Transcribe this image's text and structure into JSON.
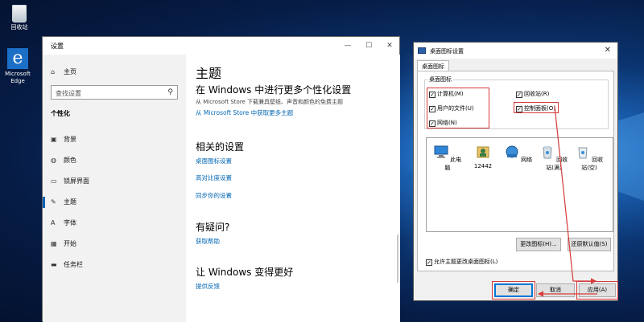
{
  "desktop": {
    "icons": [
      {
        "label": "回收站",
        "icon": "recycle-bin-icon"
      },
      {
        "label": "Microsoft Edge",
        "icon": "edge-icon"
      }
    ]
  },
  "settings": {
    "window_title": "设置",
    "controls": {
      "minimize": "—",
      "maximize": "☐",
      "close": "✕"
    },
    "sidebar": {
      "home": "主页",
      "search_placeholder": "查找设置",
      "section": "个性化",
      "items": [
        {
          "label": "背景",
          "icon": "picture-icon"
        },
        {
          "label": "颜色",
          "icon": "palette-icon"
        },
        {
          "label": "锁屏界面",
          "icon": "lock-screen-icon"
        },
        {
          "label": "主题",
          "icon": "brush-icon"
        },
        {
          "label": "字体",
          "icon": "font-icon"
        },
        {
          "label": "开始",
          "icon": "start-icon"
        },
        {
          "label": "任务栏",
          "icon": "taskbar-icon"
        }
      ],
      "selected_index": 3
    },
    "main": {
      "title": "主题",
      "store_heading": "在 Windows 中进行更多个性化设置",
      "store_desc": "从 Microsoft Store 下载兼具壁纸、声音和颜色的免费主题",
      "store_link": "从 Microsoft Store 中获取更多主题",
      "related_heading": "相关的设置",
      "related_links": [
        "桌面图标设置",
        "高对比度设置",
        "同步你的设置"
      ],
      "question_heading": "有疑问?",
      "help_link": "获取帮助",
      "improve_heading": "让 Windows 变得更好",
      "feedback_link": "提供反馈"
    }
  },
  "dialog": {
    "title": "桌面图标设置",
    "close": "✕",
    "tab": "桌面图标",
    "group_label": "桌面图标",
    "checkboxes": [
      {
        "label": "计算机(M)",
        "checked": true
      },
      {
        "label": "回收站(R)",
        "checked": true
      },
      {
        "label": "用户的文件(U)",
        "checked": true
      },
      {
        "label": "控制面板(O)",
        "checked": true
      },
      {
        "label": "网络(N)",
        "checked": true
      }
    ],
    "icons": [
      {
        "label": "此电脑",
        "icon": "computer-icon"
      },
      {
        "label": "12442",
        "icon": "user-folder-icon"
      },
      {
        "label": "网络",
        "icon": "network-icon"
      },
      {
        "label": "回收站(满)",
        "icon": "recycle-bin-full-icon"
      },
      {
        "label": "回收站(空)",
        "icon": "recycle-bin-empty-icon"
      }
    ],
    "change_icon_button": "更改图标(H)...",
    "restore_default_button": "还原默认值(S)",
    "allow_themes_label": "允许主题更改桌面图标(L)",
    "allow_themes_checked": true,
    "ok_button": "确定",
    "cancel_button": "取消",
    "apply_button": "应用(A)"
  },
  "colors": {
    "accent": "#0078d7",
    "annotation_red": "#d63a3a",
    "link": "#0066b4"
  }
}
